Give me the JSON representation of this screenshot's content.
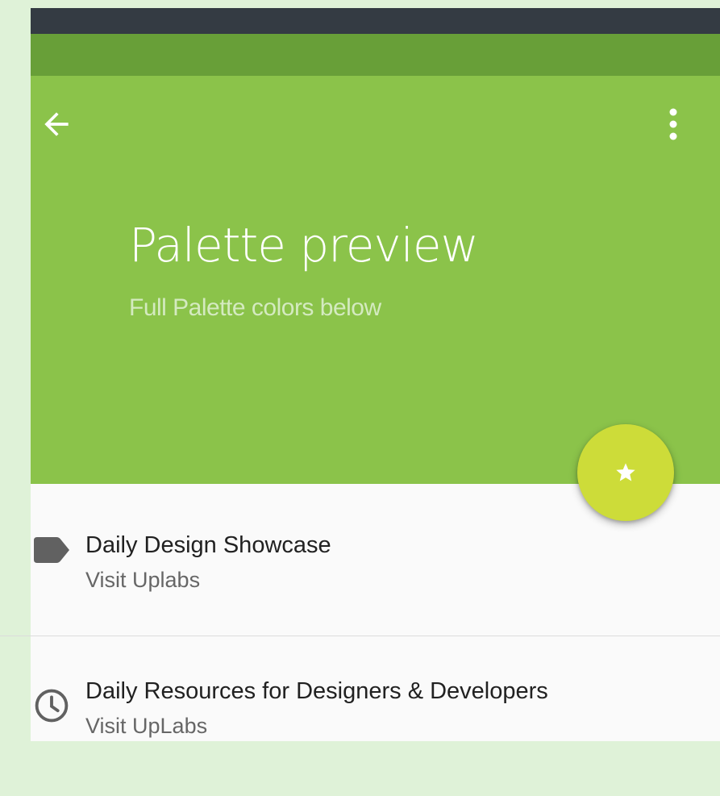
{
  "colors": {
    "status_bar": "#343b43",
    "primary_dark": "#689f38",
    "primary": "#8bc34a",
    "accent": "#cddc39",
    "list_background": "#fafafa",
    "icon_grey": "#616161"
  },
  "app_bar": {
    "back_icon": "arrow-back-icon",
    "overflow_icon": "more-vert-icon"
  },
  "hero": {
    "title": "Palette preview",
    "subtitle": "Full Palette colors below"
  },
  "fab": {
    "icon": "star-icon"
  },
  "list": {
    "items": [
      {
        "icon": "label-icon",
        "title": "Daily Design Showcase",
        "subtitle": "Visit Uplabs"
      },
      {
        "icon": "clock-icon",
        "title": "Daily Resources for Designers & Developers",
        "subtitle": "Visit UpLabs"
      }
    ]
  }
}
